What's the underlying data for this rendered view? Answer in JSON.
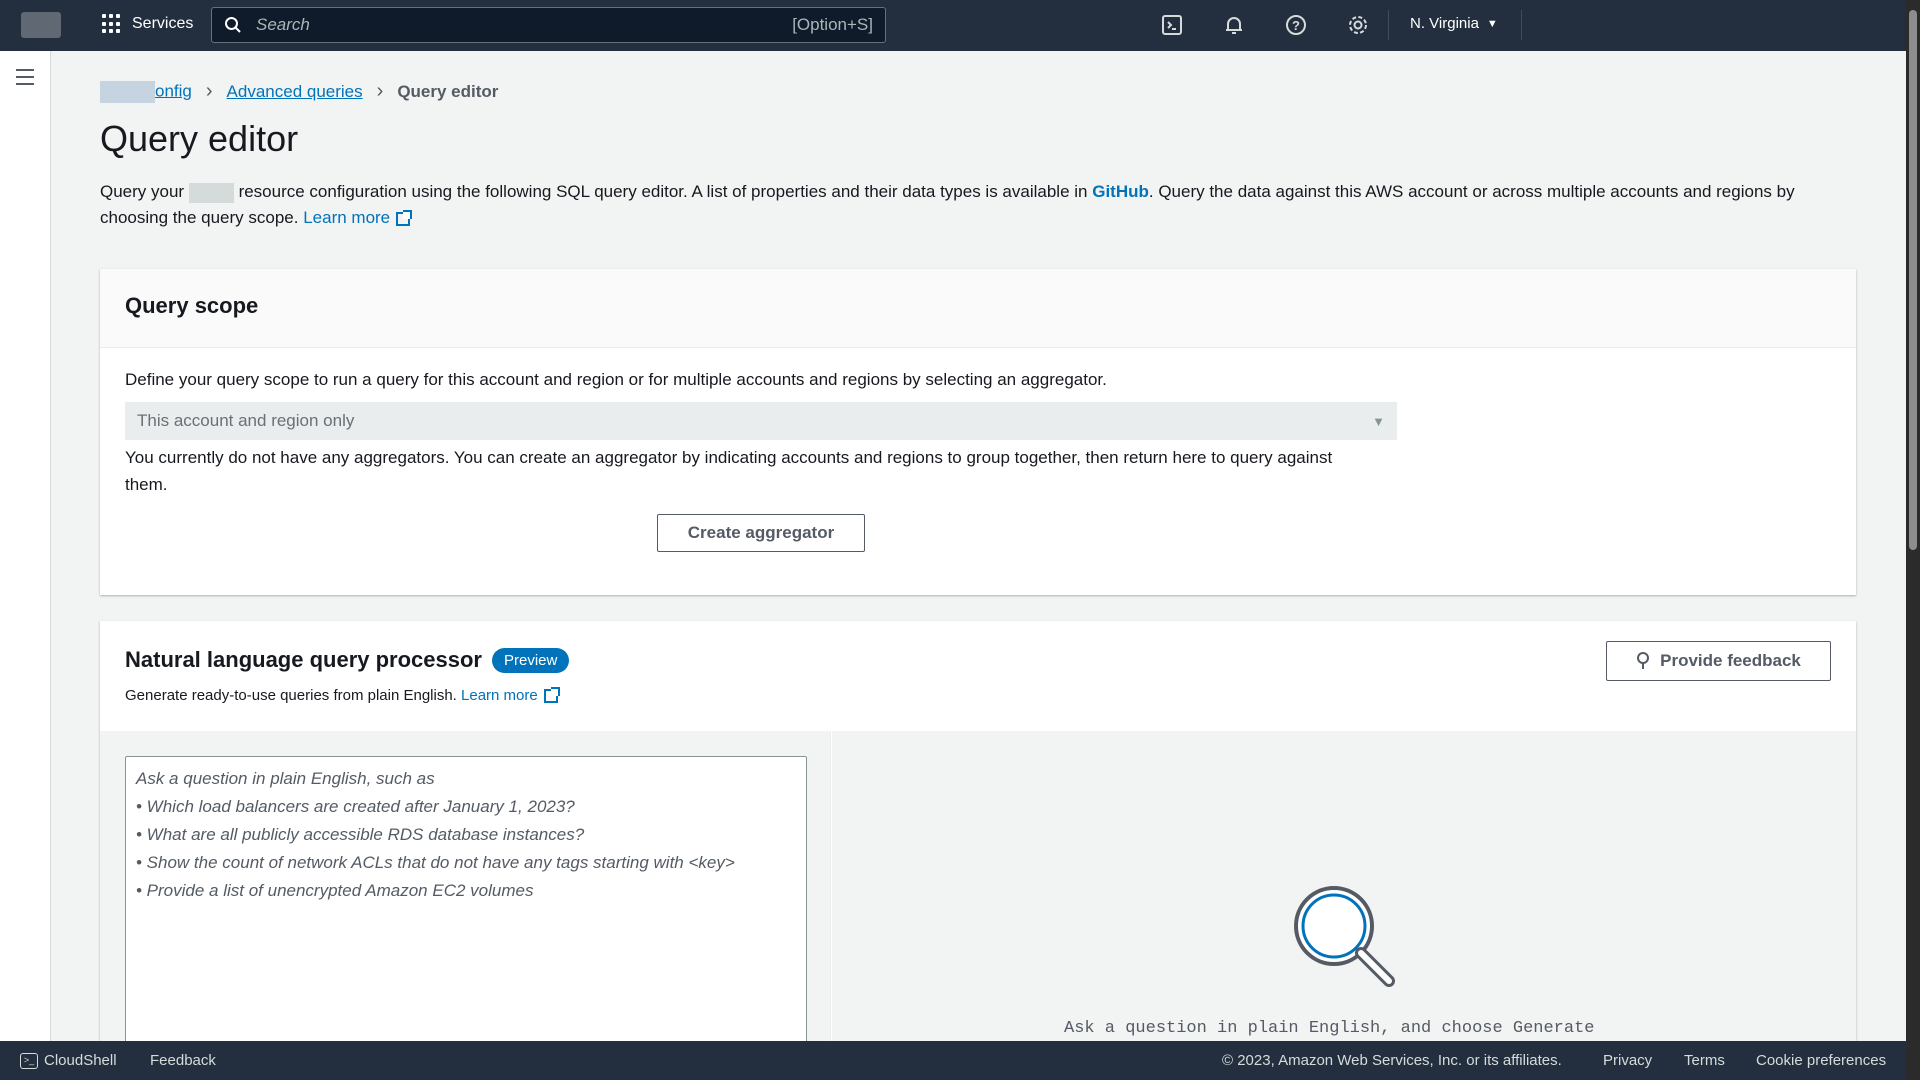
{
  "topbar": {
    "services_label": "Services",
    "search_placeholder": "Search",
    "search_shortcut": "[Option+S]",
    "region": "N. Virginia"
  },
  "breadcrumb": {
    "items": [
      "onfig",
      "Advanced queries",
      "Query editor"
    ]
  },
  "page": {
    "title": "Query editor",
    "desc_part1": "Query your",
    "desc_part2": "resource configuration using the following SQL query editor. A list of properties and their data types is available in",
    "desc_link_github": "GitHub",
    "desc_part3": ". Query the data against this AWS account or across multiple accounts and regions by choosing the query scope.",
    "desc_learn_more": "Learn more"
  },
  "scope": {
    "title": "Query scope",
    "description": "Define your query scope to run a query for this account and region or for multiple accounts and regions by selecting an aggregator.",
    "select_value": "This account and region only",
    "note": "You currently do not have any aggregators. You can create an aggregator by indicating accounts and regions to group together, then return here to query against them.",
    "create_button": "Create aggregator"
  },
  "nlq": {
    "title": "Natural language query processor",
    "badge": "Preview",
    "subtitle": "Generate ready-to-use queries from plain English.",
    "learn_more": "Learn more",
    "feedback_button": "Provide feedback",
    "placeholder_lines": [
      "Ask a question in plain English, such as",
      "• Which load balancers are created after January 1, 2023?",
      "• What are all publicly accessible RDS database instances?",
      "• Show the count of network ACLs that do not have any tags starting with <key>",
      "• Provide a list of unencrypted Amazon EC2 volumes"
    ],
    "result_text": "Ask a question in plain English, and choose Generate"
  },
  "footer": {
    "cloudshell": "CloudShell",
    "feedback": "Feedback",
    "copyright": "© 2023, Amazon Web Services, Inc. or its affiliates.",
    "privacy": "Privacy",
    "terms": "Terms",
    "cookies": "Cookie preferences"
  }
}
